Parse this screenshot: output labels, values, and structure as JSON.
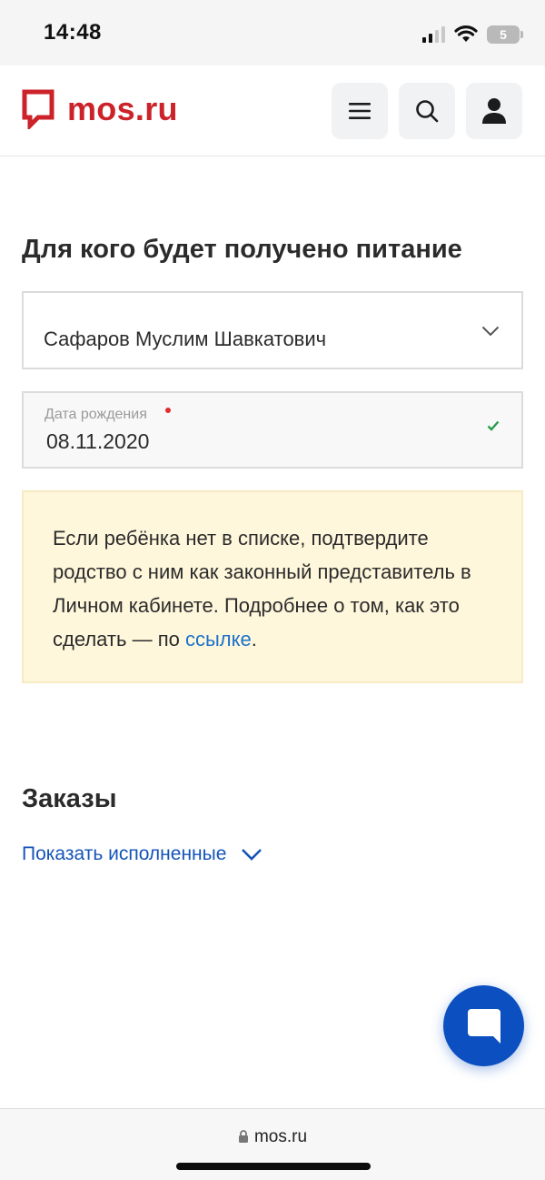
{
  "status_bar": {
    "time": "14:48",
    "battery": "5",
    "icons": [
      "signal-icon",
      "wifi-icon",
      "battery-icon"
    ]
  },
  "header": {
    "logo_text": "mos.ru",
    "logo_icon": "mos-logo-icon",
    "menu_icon": "menu-icon",
    "search_icon": "search-icon",
    "profile_icon": "user-icon",
    "brand_color": "#cc2229"
  },
  "form": {
    "title": "Для кого будет получено питание",
    "child_select": {
      "value": "Сафаров Муслим Шавкатович",
      "icon": "chevron-down-icon"
    },
    "birth_date": {
      "label": "Дата рождения",
      "value": "08.11.2020",
      "icon": "check-icon"
    }
  },
  "notice": {
    "text": "Если ребёнка нет в списке, подтвердите родство с ним как законный представитель в Личном кабинете. Подробнее о том, как это сделать — по ",
    "link_text": "ссылке",
    "end": "."
  },
  "orders": {
    "title": "Заказы",
    "show_completed": "Показать исполненные"
  },
  "chat": {
    "icon": "chat-icon",
    "color": "#0b4fc0"
  },
  "browser": {
    "url": "mos.ru",
    "icon": "lock-icon"
  }
}
